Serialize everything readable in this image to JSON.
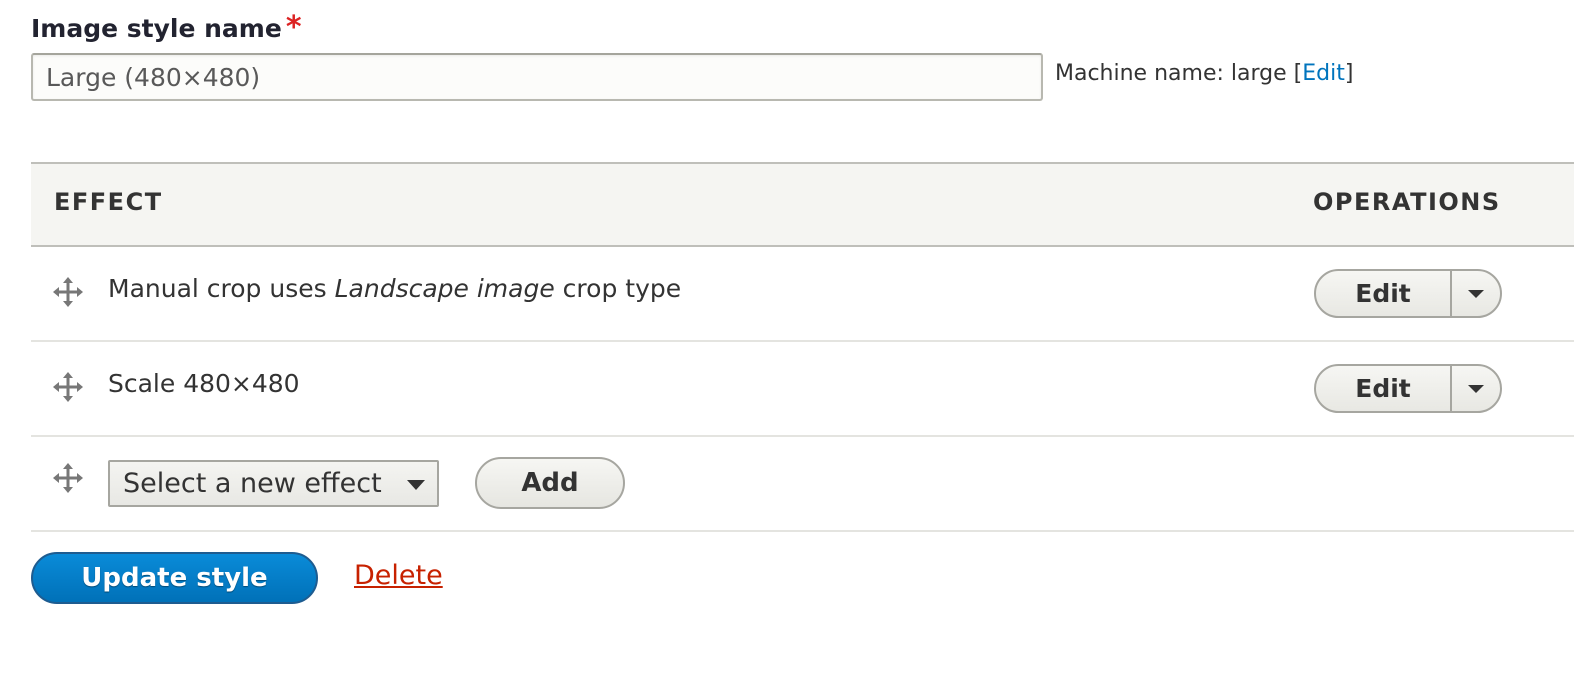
{
  "field": {
    "label": "Image style name",
    "required_mark": "*",
    "value": "Large (480×480)"
  },
  "machine_name": {
    "prefix": "Machine name: large [",
    "edit_link": "Edit",
    "suffix": "]"
  },
  "table": {
    "headers": {
      "effect": "EFFECT",
      "operations": "OPERATIONS"
    },
    "rows": [
      {
        "text_before": "Manual crop uses ",
        "text_italic": "Landscape image",
        "text_after": " crop type",
        "operation_label": "Edit"
      },
      {
        "text": "Scale 480×480",
        "operation_label": "Edit"
      }
    ],
    "new_effect": {
      "select_value": "Select a new effect",
      "add_label": "Add"
    }
  },
  "actions": {
    "submit_label": "Update style",
    "delete_label": "Delete"
  },
  "colors": {
    "primary_button": "#0071b8",
    "link": "#0074bd",
    "danger_link": "#c72100",
    "required": "#dc2323",
    "header_bg": "#f5f5f2"
  }
}
